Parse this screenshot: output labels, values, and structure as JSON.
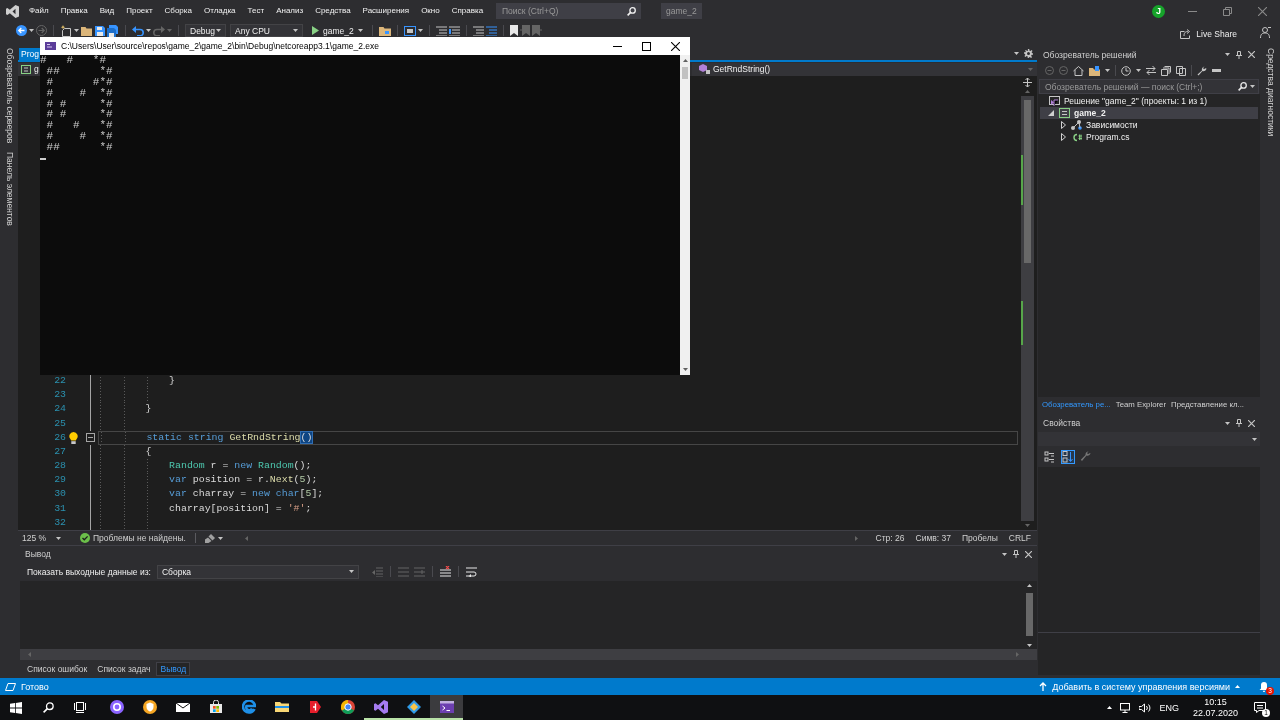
{
  "title_bar": {
    "menu": [
      "Файл",
      "Правка",
      "Вид",
      "Проект",
      "Сборка",
      "Отладка",
      "Тест",
      "Анализ",
      "Средства",
      "Расширения",
      "Окно",
      "Справка"
    ],
    "search": {
      "placeholder": "Поиск (Ctrl+Q)"
    },
    "solution": "game_2",
    "account": "J"
  },
  "toolbar": {
    "configuration": "Debug",
    "platform": "Any CPU",
    "start": "game_2",
    "live_share": "Live Share"
  },
  "left_strip": [
    "Обозреватель серверов",
    "Панель элементов"
  ],
  "editor": {
    "tabs": [
      {
        "label": "Prog",
        "selected": true
      }
    ],
    "navigation": {
      "project": "g",
      "member": "GetRndString()"
    },
    "lines": [
      {
        "number": "22",
        "current": false,
        "lightbulb": false,
        "collapsible": false,
        "tokens": [
          {
            "kind": "plain",
            "text": "            }"
          }
        ]
      },
      {
        "number": "23",
        "current": false,
        "lightbulb": false,
        "collapsible": false
      },
      {
        "number": "24",
        "current": false,
        "lightbulb": false,
        "collapsible": false,
        "tokens": [
          {
            "kind": "plain",
            "text": "        }"
          }
        ]
      },
      {
        "number": "25",
        "current": false,
        "lightbulb": false,
        "collapsible": false
      },
      {
        "number": "26",
        "current": true,
        "lightbulb": true,
        "collapsible": true,
        "tokens": [
          {
            "kind": "keyword",
            "text": "        static string "
          },
          {
            "kind": "method",
            "text": "GetRndString"
          },
          {
            "kind": "brace_match",
            "text": "()"
          }
        ]
      },
      {
        "number": "27",
        "current": false,
        "lightbulb": false,
        "collapsible": false,
        "tokens": [
          {
            "kind": "plain",
            "text": "        {"
          }
        ]
      },
      {
        "number": "28",
        "current": false,
        "lightbulb": false,
        "collapsible": false,
        "tokens": [
          {
            "kind": "type",
            "text": "            Random"
          },
          {
            "kind": "plain",
            "text": " r = "
          },
          {
            "kind": "keyword",
            "text": "new "
          },
          {
            "kind": "type",
            "text": "Random"
          },
          {
            "kind": "plain",
            "text": "();"
          }
        ]
      },
      {
        "number": "29",
        "current": false,
        "lightbulb": false,
        "collapsible": false,
        "tokens": [
          {
            "kind": "keyword",
            "text": "            var"
          },
          {
            "kind": "plain",
            "text": " position = r."
          },
          {
            "kind": "method",
            "text": "Next"
          },
          {
            "kind": "plain",
            "text": "("
          },
          {
            "kind": "number",
            "text": "5"
          },
          {
            "kind": "plain",
            "text": ");"
          }
        ]
      },
      {
        "number": "30",
        "current": false,
        "lightbulb": false,
        "collapsible": false,
        "tokens": [
          {
            "kind": "keyword",
            "text": "            var"
          },
          {
            "kind": "plain",
            "text": " charray = "
          },
          {
            "kind": "keyword",
            "text": "new char"
          },
          {
            "kind": "plain",
            "text": "["
          },
          {
            "kind": "number",
            "text": "5"
          },
          {
            "kind": "plain",
            "text": "];"
          }
        ]
      },
      {
        "number": "31",
        "current": false,
        "lightbulb": false,
        "collapsible": false,
        "tokens": [
          {
            "kind": "plain",
            "text": "            charray[position] = "
          },
          {
            "kind": "string",
            "text": "'#'"
          },
          {
            "kind": "plain",
            "text": ";"
          }
        ]
      },
      {
        "number": "32",
        "current": false,
        "lightbulb": false,
        "collapsible": false
      }
    ],
    "status": {
      "zoom": "125 %",
      "issues": "Проблемы не найдены.",
      "line": "Стр: 26",
      "column": "Симв: 37",
      "whitespace": "Пробелы",
      "line_endings": "CRLF"
    }
  },
  "console": {
    "title": "C:\\Users\\User\\source\\repos\\game_2\\game_2\\bin\\Debug\\netcoreapp3.1\\game_2.exe",
    "lines": [
      "#   #   *#",
      " ##      *#",
      " #      #*#",
      " #    #  *#",
      " # #     *#",
      " # #     *#",
      " #   #   *#",
      " #    #  *#",
      " ##      *#"
    ],
    "cursor": true
  },
  "output": {
    "title": "Вывод",
    "source_label": "Показать выходные данные из:",
    "source": "Сборка"
  },
  "bottom_tabs": [
    {
      "label": "Список ошибок",
      "selected": false
    },
    {
      "label": "Список задач",
      "selected": false
    },
    {
      "label": "Вывод",
      "selected": true
    }
  ],
  "solution_explorer": {
    "title": "Обозреватель решений",
    "search": {
      "placeholder": "Обозреватель решений — поиск (Ctrl+;)"
    },
    "tree": [
      {
        "label": "Решение \"game_2\" (проекты: 1 из 1)",
        "kind": "solution",
        "selected": false,
        "startup": false,
        "children": [
          {
            "label": "game_2",
            "kind": "project",
            "expanded": true,
            "selected": true,
            "startup": true,
            "children": [
              {
                "label": "Зависимости",
                "kind": "dependencies",
                "expanded": false,
                "selected": false,
                "startup": false
              },
              {
                "label": "Program.cs",
                "kind": "code_file",
                "expanded": false,
                "selected": false,
                "startup": false
              }
            ]
          }
        ]
      }
    ]
  },
  "panel_tabs": [
    {
      "label": "Обозреватель ре...",
      "selected": true
    },
    {
      "label": "Team Explorer",
      "selected": false
    },
    {
      "label": "Представление кл...",
      "selected": false
    }
  ],
  "properties": {
    "title": "Свойства",
    "view_buttons": [
      {
        "kind": "categorized",
        "selected": false,
        "disabled": false
      },
      {
        "kind": "alphabetical",
        "selected": true,
        "disabled": false
      },
      {
        "kind": "property_pages",
        "selected": false,
        "disabled": true
      }
    ]
  },
  "right_strip": [
    "Средства диагностики"
  ],
  "status_bar": {
    "state": "Готово",
    "source_control": "Добавить в систему управления версиями",
    "notifications": "3"
  },
  "taskbar": {
    "apps": [
      {
        "kind": "ring",
        "running": false,
        "active": false
      },
      {
        "kind": "shield",
        "running": false,
        "active": false
      },
      {
        "kind": "envelope",
        "running": false,
        "active": false
      },
      {
        "kind": "bag",
        "running": false,
        "active": false
      },
      {
        "kind": "swirl",
        "running": false,
        "active": false
      },
      {
        "kind": "folder",
        "running": false,
        "active": false
      },
      {
        "kind": "tag",
        "running": false,
        "active": false
      },
      {
        "kind": "wheel",
        "running": false,
        "active": false
      },
      {
        "kind": "ribbon",
        "running": true,
        "active": false
      },
      {
        "kind": "diamond",
        "running": true,
        "active": false
      },
      {
        "kind": "terminal",
        "running": true,
        "active": true
      }
    ],
    "language": "ENG",
    "time": "10:15",
    "date": "22.07.2020",
    "notifications": "1"
  }
}
